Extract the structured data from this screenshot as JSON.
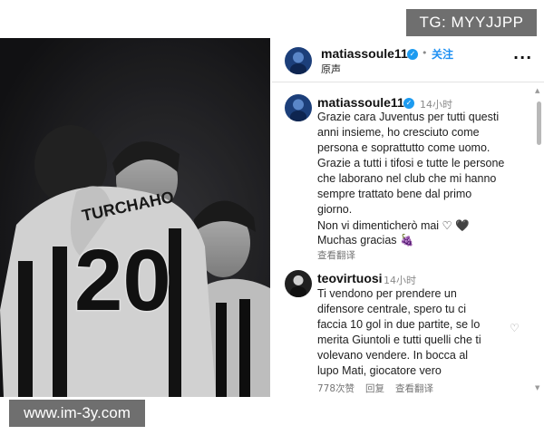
{
  "watermarks": {
    "telegram": "TG: MYYJJPP",
    "site": "www.im-3y.com"
  },
  "photo": {
    "jersey_name": "TURCHAHO",
    "jersey_number": "20"
  },
  "header": {
    "username": "matiassoule11",
    "follow_label": "关注",
    "subtitle": "原声",
    "more_icon": "more-horizontal-icon"
  },
  "caption": {
    "username": "matiassoule11",
    "time": "14小时",
    "lines": [
      "Grazie cara Juventus per tutti questi",
      "anni insieme, ho cresciuto come",
      "persona e soprattutto come uomo.",
      "Grazie a tutti i tifosi e tutte le persone",
      "che laborano nel club che mi hanno",
      "sempre trattato bene dal primo",
      "giorno.",
      "Non vi dimenticherò mai ♡ 🖤",
      "Muchas gracias 🍇"
    ],
    "translate_label": "查看翻译"
  },
  "comment": {
    "username": "teovirtuosi",
    "time": "14小时",
    "lines": [
      "Ti vendono per prendere un",
      "difensore centrale, spero tu ci",
      "faccia 10 gol in due partite, se lo",
      "merita Giuntoli e tutti quelli che ti",
      "volevano vendere. In bocca al",
      "lupo Mati, giocatore vero"
    ],
    "likes": "778次赞",
    "reply_label": "回复",
    "translate_label": "查看翻译"
  },
  "colors": {
    "accent": "#1d8ff2",
    "verified": "#1d9bf0"
  }
}
